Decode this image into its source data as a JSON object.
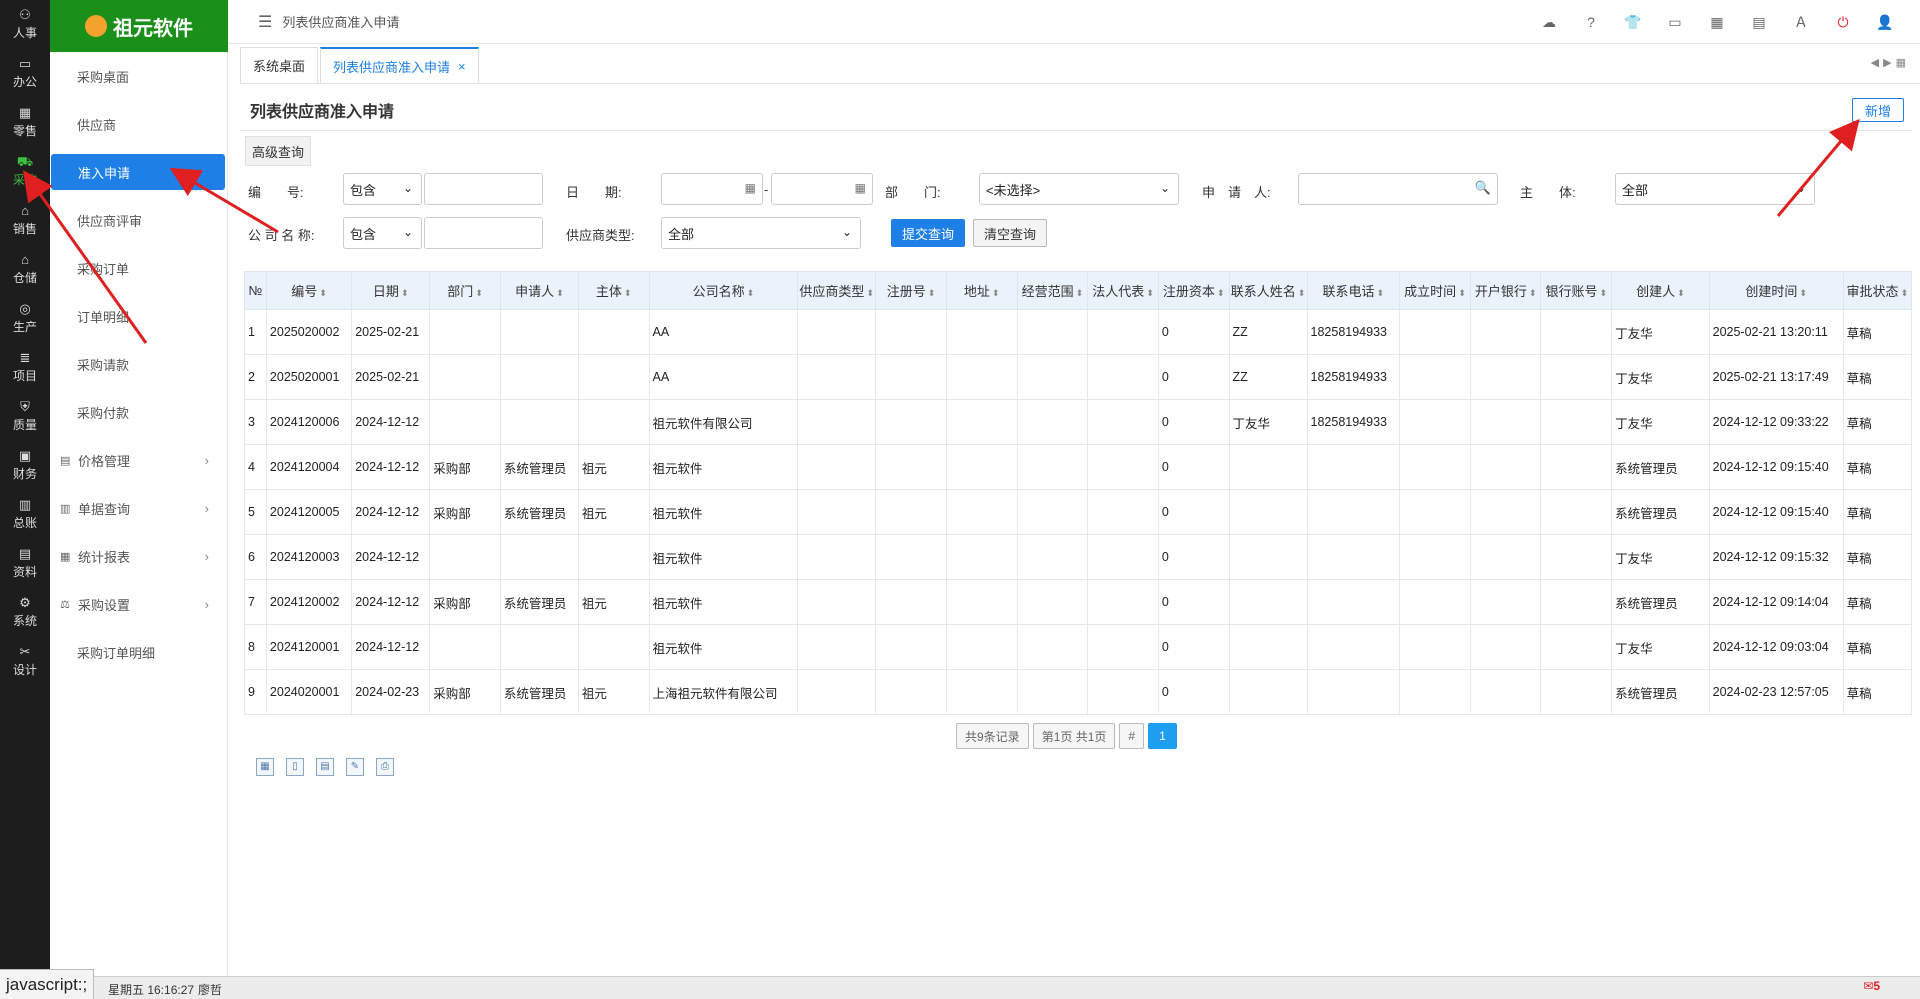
{
  "rail": [
    {
      "label": "人事",
      "icon": "people-icon"
    },
    {
      "label": "办公",
      "icon": "monitor-icon"
    },
    {
      "label": "零售",
      "icon": "store-icon"
    },
    {
      "label": "采购",
      "icon": "truck-icon",
      "active": true
    },
    {
      "label": "销售",
      "icon": "sales-icon"
    },
    {
      "label": "仓储",
      "icon": "warehouse-icon"
    },
    {
      "label": "生产",
      "icon": "production-icon"
    },
    {
      "label": "项目",
      "icon": "layers-icon"
    },
    {
      "label": "质量",
      "icon": "shield-icon"
    },
    {
      "label": "财务",
      "icon": "finance-icon"
    },
    {
      "label": "总账",
      "icon": "ledger-icon"
    },
    {
      "label": "资料",
      "icon": "doc-icon"
    },
    {
      "label": "系统",
      "icon": "gear-icon"
    },
    {
      "label": "设计",
      "icon": "tools-icon"
    }
  ],
  "logo": {
    "text": "祖元软件"
  },
  "submenu": [
    {
      "label": "采购桌面",
      "type": "item"
    },
    {
      "label": "供应商",
      "type": "item"
    },
    {
      "label": "准入申请",
      "type": "item",
      "active": true
    },
    {
      "label": "供应商评审",
      "type": "item"
    },
    {
      "label": "采购订单",
      "type": "item"
    },
    {
      "label": "订单明细",
      "type": "item"
    },
    {
      "label": "采购请款",
      "type": "item"
    },
    {
      "label": "采购付款",
      "type": "item"
    },
    {
      "label": "价格管理",
      "type": "group"
    },
    {
      "label": "单据查询",
      "type": "group"
    },
    {
      "label": "统计报表",
      "type": "group"
    },
    {
      "label": "采购设置",
      "type": "group"
    },
    {
      "label": "采购订单明细",
      "type": "item"
    }
  ],
  "topbar": {
    "breadcrumb": "列表供应商准入申请"
  },
  "tabs": [
    {
      "label": "系统桌面",
      "active": false
    },
    {
      "label": "列表供应商准入申请",
      "active": true,
      "close": "×"
    }
  ],
  "page": {
    "title": "列表供应商准入申请",
    "add_label": "新增",
    "adv_tab": "高级查询"
  },
  "filters": {
    "code_label": "编　　号:",
    "code_op": "包含",
    "date_label": "日　　期:",
    "date_sep": "-",
    "dept_label": "部　　门:",
    "dept_value": "<未选择>",
    "applicant_label": "申　请　人:",
    "entity_label": "主　　体:",
    "entity_value": "全部",
    "company_label": "公 司 名 称:",
    "company_op": "包含",
    "supplier_type_label": "供应商类型:",
    "supplier_type_value": "全部",
    "submit_label": "提交查询",
    "clear_label": "清空查询"
  },
  "table": {
    "columns": [
      "№",
      "编号",
      "日期",
      "部门",
      "申请人",
      "主体",
      "公司名称",
      "供应商类型",
      "注册号",
      "地址",
      "经营范围",
      "法人代表",
      "注册资本",
      "联系人姓名",
      "联系电话",
      "成立时间",
      "开户银行",
      "银行账号",
      "创建人",
      "创建时间",
      "审批状态"
    ],
    "rows": [
      [
        "1",
        "2025020002",
        "2025-02-21",
        "",
        "",
        "",
        "AA",
        "",
        "",
        "",
        "",
        "",
        "0",
        "ZZ",
        "18258194933",
        "",
        "",
        "",
        "丁友华",
        "2025-02-21 13:20:11",
        "草稿"
      ],
      [
        "2",
        "2025020001",
        "2025-02-21",
        "",
        "",
        "",
        "AA",
        "",
        "",
        "",
        "",
        "",
        "0",
        "ZZ",
        "18258194933",
        "",
        "",
        "",
        "丁友华",
        "2025-02-21 13:17:49",
        "草稿"
      ],
      [
        "3",
        "2024120006",
        "2024-12-12",
        "",
        "",
        "",
        "祖元软件有限公司",
        "",
        "",
        "",
        "",
        "",
        "0",
        "丁友华",
        "18258194933",
        "",
        "",
        "",
        "丁友华",
        "2024-12-12 09:33:22",
        "草稿"
      ],
      [
        "4",
        "2024120004",
        "2024-12-12",
        "采购部",
        "系统管理员",
        "祖元",
        "祖元软件",
        "",
        "",
        "",
        "",
        "",
        "0",
        "",
        "",
        "",
        "",
        "",
        "系统管理员",
        "2024-12-12 09:15:40",
        "草稿"
      ],
      [
        "5",
        "2024120005",
        "2024-12-12",
        "采购部",
        "系统管理员",
        "祖元",
        "祖元软件",
        "",
        "",
        "",
        "",
        "",
        "0",
        "",
        "",
        "",
        "",
        "",
        "系统管理员",
        "2024-12-12 09:15:40",
        "草稿"
      ],
      [
        "6",
        "2024120003",
        "2024-12-12",
        "",
        "",
        "",
        "祖元软件",
        "",
        "",
        "",
        "",
        "",
        "0",
        "",
        "",
        "",
        "",
        "",
        "丁友华",
        "2024-12-12 09:15:32",
        "草稿"
      ],
      [
        "7",
        "2024120002",
        "2024-12-12",
        "采购部",
        "系统管理员",
        "祖元",
        "祖元软件",
        "",
        "",
        "",
        "",
        "",
        "0",
        "",
        "",
        "",
        "",
        "",
        "系统管理员",
        "2024-12-12 09:14:04",
        "草稿"
      ],
      [
        "8",
        "2024120001",
        "2024-12-12",
        "",
        "",
        "",
        "祖元软件",
        "",
        "",
        "",
        "",
        "",
        "0",
        "",
        "",
        "",
        "",
        "",
        "丁友华",
        "2024-12-12 09:03:04",
        "草稿"
      ],
      [
        "9",
        "2024020001",
        "2024-02-23",
        "采购部",
        "系统管理员",
        "祖元",
        "上海祖元软件有限公司",
        "",
        "",
        "",
        "",
        "",
        "0",
        "",
        "",
        "",
        "",
        "",
        "系统管理员",
        "2024-02-23 12:57:05",
        "草稿"
      ]
    ]
  },
  "pager": {
    "total": "共9条记录",
    "pages": "第1页 共1页",
    "hash": "#",
    "current": "1"
  },
  "status": {
    "url": "javascript:;",
    "time": "星期五 16:16:27",
    "user": "廖哲",
    "msg_count": "5"
  },
  "colors": {
    "accent": "#1e7fe6",
    "brand": "#1a8f1a",
    "rail_bg": "#1d1d1d",
    "annotation": "#e02020"
  }
}
